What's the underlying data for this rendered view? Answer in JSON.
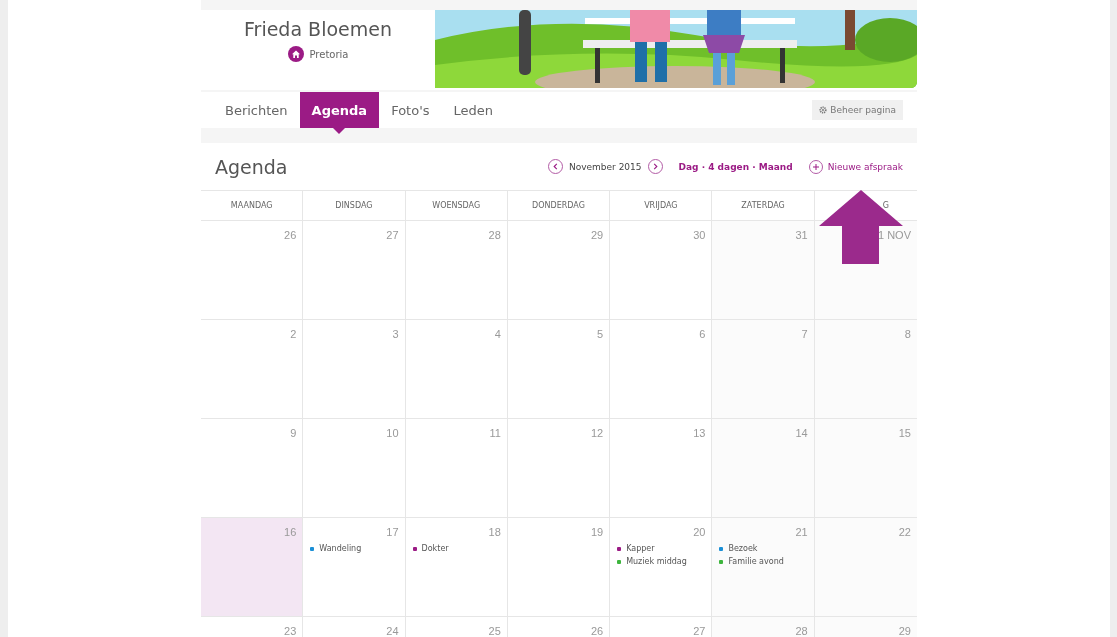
{
  "profile": {
    "name": "Frieda Bloemen",
    "location": "Pretoria"
  },
  "tabs": [
    {
      "label": "Berichten",
      "selected": false
    },
    {
      "label": "Agenda",
      "selected": true
    },
    {
      "label": "Foto's",
      "selected": false
    },
    {
      "label": "Leden",
      "selected": false
    }
  ],
  "manage_button": "Beheer pagina",
  "agenda": {
    "title": "Agenda",
    "month": "November 2015",
    "view_switch": "Dag · 4 dagen · Maand",
    "new_button": "Nieuwe afspraak",
    "columns": [
      "MAANDAG",
      "DINSDAG",
      "WOENSDAG",
      "DONDERDAG",
      "VRIJDAG",
      "ZATERDAG",
      "G"
    ],
    "weeks": [
      [
        {
          "label": "26",
          "today": false
        },
        {
          "label": "27",
          "today": false
        },
        {
          "label": "28",
          "today": false
        },
        {
          "label": "29",
          "today": false
        },
        {
          "label": "30",
          "today": false
        },
        {
          "label": "31",
          "today": false
        },
        {
          "label": "1 NOV",
          "today": false
        }
      ],
      [
        {
          "label": "2",
          "today": false
        },
        {
          "label": "3",
          "today": false
        },
        {
          "label": "4",
          "today": false
        },
        {
          "label": "5",
          "today": false
        },
        {
          "label": "6",
          "today": false
        },
        {
          "label": "7",
          "today": false
        },
        {
          "label": "8",
          "today": false
        }
      ],
      [
        {
          "label": "9",
          "today": false
        },
        {
          "label": "10",
          "today": false
        },
        {
          "label": "11",
          "today": false
        },
        {
          "label": "12",
          "today": false
        },
        {
          "label": "13",
          "today": false
        },
        {
          "label": "14",
          "today": false
        },
        {
          "label": "15",
          "today": false
        }
      ],
      [
        {
          "label": "16",
          "today": true
        },
        {
          "label": "17",
          "today": false,
          "events": [
            {
              "title": "Wandeling",
              "color": "#1a8fd6"
            }
          ]
        },
        {
          "label": "18",
          "today": false,
          "events": [
            {
              "title": "Dokter",
              "color": "#9b1b85"
            }
          ]
        },
        {
          "label": "19",
          "today": false
        },
        {
          "label": "20",
          "today": false,
          "events": [
            {
              "title": "Kapper",
              "color": "#9b1b85"
            },
            {
              "title": "Muziek middag",
              "color": "#3db53d"
            }
          ]
        },
        {
          "label": "21",
          "today": false,
          "events": [
            {
              "title": "Bezoek",
              "color": "#1a8fd6"
            },
            {
              "title": "Familie avond",
              "color": "#3db53d"
            }
          ]
        },
        {
          "label": "22",
          "today": false
        }
      ],
      [
        {
          "label": "23",
          "today": false
        },
        {
          "label": "24",
          "today": false
        },
        {
          "label": "25",
          "today": false
        },
        {
          "label": "26",
          "today": false
        },
        {
          "label": "27",
          "today": false
        },
        {
          "label": "28",
          "today": false
        },
        {
          "label": "29",
          "today": false
        }
      ]
    ]
  }
}
